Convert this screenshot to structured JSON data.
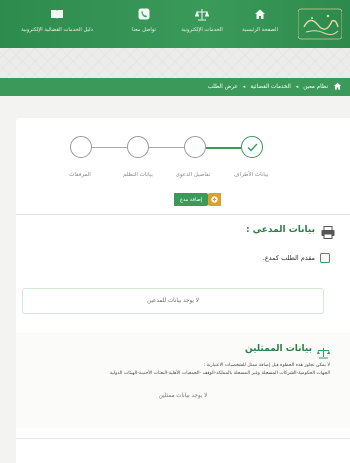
{
  "header": {
    "logo_text": "ديوان المظالم",
    "nav": [
      {
        "label": "الصفحة الرئيسية",
        "icon": "home-icon"
      },
      {
        "label": "الخدمات الإلكترونية",
        "icon": "scales-icon"
      },
      {
        "label": "تواصل معنا",
        "icon": "phone-icon"
      },
      {
        "label": "دليل الخدمات القضائية الإلكترونية",
        "icon": "book-icon"
      }
    ]
  },
  "breadcrumb": {
    "items": [
      "نظام معين",
      "الخدمات القضائية",
      "عرض الطلب"
    ],
    "home_icon": "home-icon"
  },
  "stepper": {
    "steps": [
      "بيانات الأطراف",
      "تفاصيل الدعوى",
      "بيانات التظلم",
      "المرفقات"
    ],
    "completed_index": 0
  },
  "add_button": {
    "label": "إضافة مدع"
  },
  "plaintiff": {
    "title": "بيانات المدعي :",
    "checkbox_label": "مقدم الطلب كمدع.",
    "empty_text": "لا يوجد بيانات للمدعين"
  },
  "representatives": {
    "title": "بيانات الممثلين",
    "note_line1": "لا يمكن تجاوز هذه الخطوة قبل إضافة ممثل للشخصيات الاعتبارية :",
    "note_line2": "الجهات الحكومية-الشركات المسجلة وغير المسجلة بالمملكة-الوقف -الجمعيات الأهلية-البعثات الأجنبية-الهيئات الدولية",
    "empty_text": "لا يوجد بيانات ممثلين"
  },
  "colors": {
    "primary": "#3a9a5a",
    "accent": "#e0a020"
  }
}
